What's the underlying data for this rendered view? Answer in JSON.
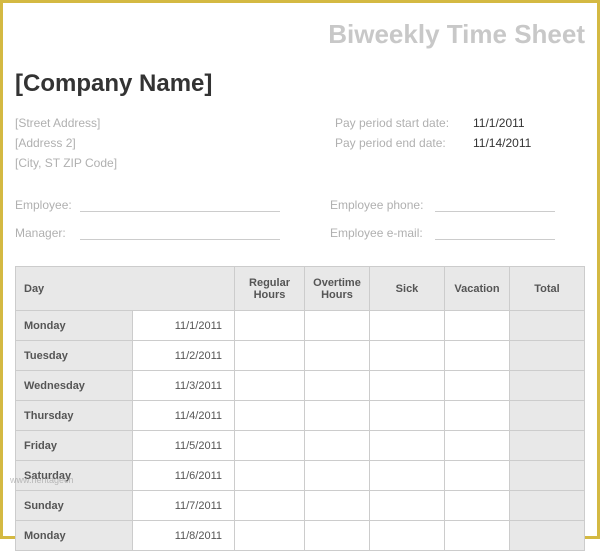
{
  "title": "Biweekly Time Sheet",
  "company_name": "[Company Name]",
  "address": {
    "street": "[Street Address]",
    "address2": "[Address 2]",
    "city_state_zip": "[City, ST  ZIP Code]"
  },
  "pay_period": {
    "start_label": "Pay period start date:",
    "start_value": "11/1/2011",
    "end_label": "Pay period end date:",
    "end_value": "11/14/2011"
  },
  "form": {
    "employee_label": "Employee:",
    "manager_label": "Manager:",
    "employee_phone_label": "Employee phone:",
    "employee_email_label": "Employee e-mail:"
  },
  "table": {
    "headers": {
      "day": "Day",
      "regular": "Regular Hours",
      "overtime": "Overtime Hours",
      "sick": "Sick",
      "vacation": "Vacation",
      "total": "Total"
    },
    "rows": [
      {
        "day": "Monday",
        "date": "11/1/2011"
      },
      {
        "day": "Tuesday",
        "date": "11/2/2011"
      },
      {
        "day": "Wednesday",
        "date": "11/3/2011"
      },
      {
        "day": "Thursday",
        "date": "11/4/2011"
      },
      {
        "day": "Friday",
        "date": "11/5/2011"
      },
      {
        "day": "Saturday",
        "date": "11/6/2011"
      },
      {
        "day": "Sunday",
        "date": "11/7/2011"
      },
      {
        "day": "Monday",
        "date": "11/8/2011"
      }
    ]
  },
  "watermark": "www.heritagech"
}
